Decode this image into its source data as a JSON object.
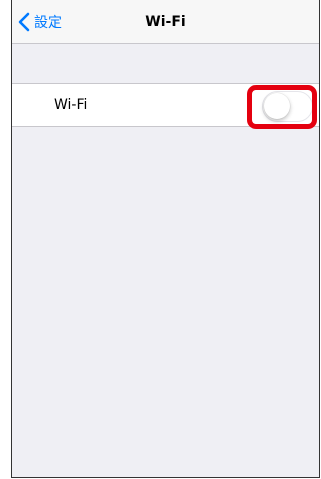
{
  "navbar": {
    "back_label": "設定",
    "title": "Wi-Fi"
  },
  "wifi_row": {
    "label": "Wi-Fi",
    "toggle_on": false
  },
  "colors": {
    "accent": "#007aff",
    "background": "#efeff4",
    "highlight": "#e4000f"
  },
  "icons": {
    "back": "chevron-left-icon"
  }
}
